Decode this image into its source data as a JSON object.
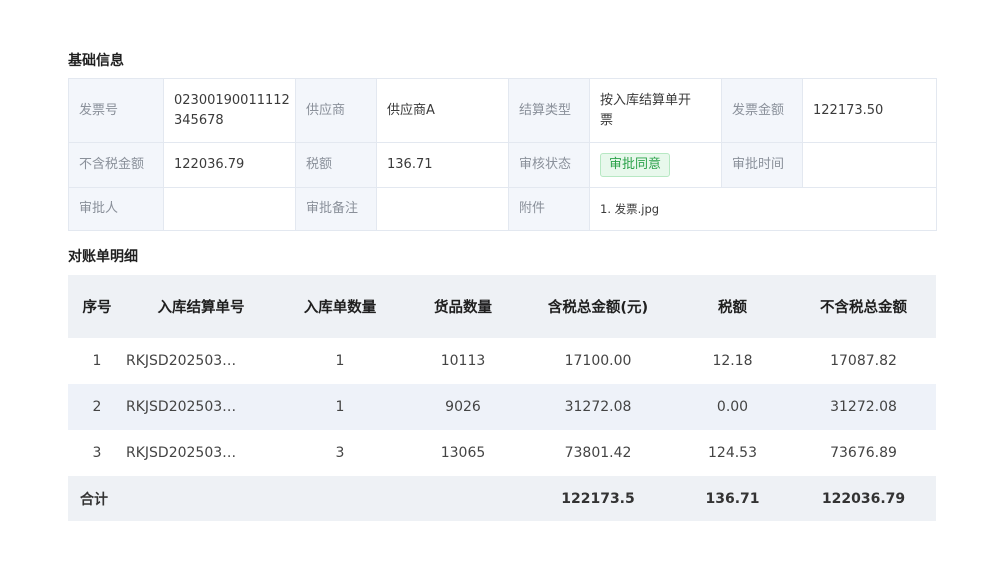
{
  "sections": {
    "basic_info_title": "基础信息",
    "detail_title": "对账单明细"
  },
  "info": {
    "invoice_no_label": "发票号",
    "invoice_no_line1": "02300190011112",
    "invoice_no_line2": "345678",
    "supplier_label": "供应商",
    "supplier_value": "供应商A",
    "settle_type_label": "结算类型",
    "settle_type_line1": "按入库结算单开",
    "settle_type_line2": "票",
    "invoice_amount_label": "发票金额",
    "invoice_amount_value": "122173.50",
    "ex_tax_label": "不含税金额",
    "ex_tax_value": "122036.79",
    "tax_label": "税额",
    "tax_value": "136.71",
    "review_status_label": "审核状态",
    "review_status_value": "审批同意",
    "review_time_label": "审批时间",
    "review_time_value": "",
    "approver_label": "审批人",
    "approver_value": "",
    "remark_label": "审批备注",
    "remark_value": "",
    "attachment_label": "附件",
    "attachment_value": "1. 发票.jpg"
  },
  "detail": {
    "headers": [
      "序号",
      "入库结算单号",
      "入库单数量",
      "货品数量",
      "含税总金额(元)",
      "税额",
      "不含税总金额"
    ],
    "rows": [
      [
        "1",
        "RKJSD202503…",
        "1",
        "10113",
        "17100.00",
        "12.18",
        "17087.82"
      ],
      [
        "2",
        "RKJSD202503…",
        "1",
        "9026",
        "31272.08",
        "0.00",
        "31272.08"
      ],
      [
        "3",
        "RKJSD202503…",
        "3",
        "13065",
        "73801.42",
        "124.53",
        "73676.89"
      ]
    ],
    "total": {
      "label": "合计",
      "amount": "122173.5",
      "tax": "136.71",
      "ex_tax": "122036.79"
    }
  },
  "colors": {
    "status_green": "#2ba24a",
    "label_bg": "#f3f6fb",
    "stripe_bg": "#eef2f9"
  }
}
